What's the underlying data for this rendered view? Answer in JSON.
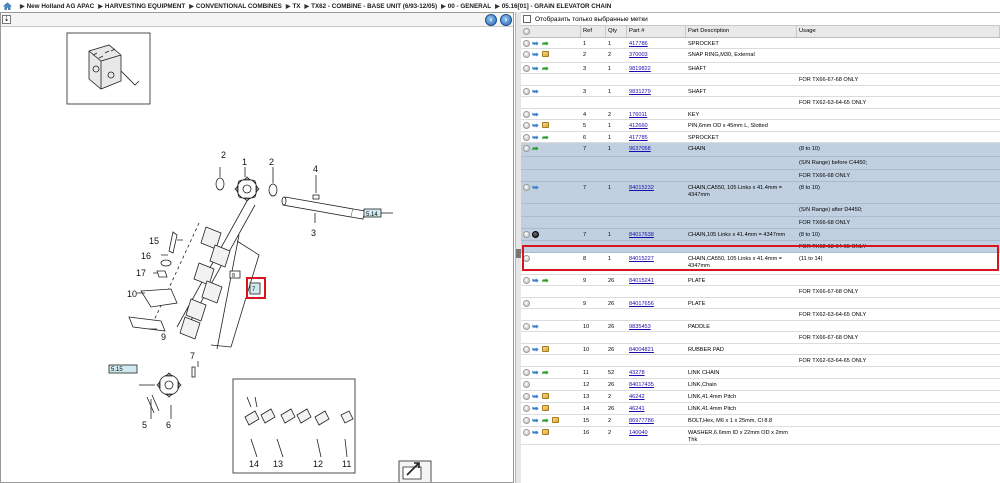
{
  "breadcrumb": [
    "New Holland AG APAC",
    "HARVESTING EQUIPMENT",
    "CONVENTIONAL COMBINES",
    "TX",
    "TX62 - COMBINE - BASE UNIT (6/93-12/05)",
    "00 - GENERAL",
    "05.16[01] - GRAIN ELEVATOR CHAIN"
  ],
  "filter_label": "Отобразить только выбранные метки",
  "columns": [
    "Ref",
    "Qty",
    "Part #",
    "Part Description",
    "Usage"
  ],
  "rows": [
    {
      "icons": [
        "info",
        "arrow",
        "green"
      ],
      "ref": "1",
      "qty": "1",
      "part": "417786",
      "desc": "SPROCKET",
      "usage": "",
      "h": 11
    },
    {
      "icons": [
        "info",
        "arrow",
        "cube"
      ],
      "ref": "2",
      "qty": "2",
      "part": "370003",
      "desc": "SNAP RING,M30, External",
      "usage": "",
      "h": 14
    },
    {
      "icons": [
        "info",
        "arrow",
        "green"
      ],
      "ref": "3",
      "qty": "1",
      "part": "9819822",
      "desc": "SHAFT",
      "usage": "",
      "h": 11
    },
    {
      "icons": [],
      "ref": "",
      "qty": "",
      "part": "",
      "desc": "",
      "usage": "FOR TX66-67-68 ONLY",
      "h": 12,
      "sub": true
    },
    {
      "icons": [
        "info",
        "arrow"
      ],
      "ref": "3",
      "qty": "1",
      "part": "9831279",
      "desc": "SHAFT",
      "usage": "",
      "h": 11
    },
    {
      "icons": [],
      "ref": "",
      "qty": "",
      "part": "",
      "desc": "",
      "usage": "FOR TX62-63-64-65 ONLY",
      "h": 12,
      "sub": true
    },
    {
      "icons": [
        "info",
        "arrow"
      ],
      "ref": "4",
      "qty": "2",
      "part": "176011",
      "desc": "KEY",
      "usage": "",
      "h": 11
    },
    {
      "icons": [
        "info",
        "arrow",
        "cube"
      ],
      "ref": "5",
      "qty": "1",
      "part": "412660",
      "desc": "PIN,6mm OD x 45mm L, Slotted",
      "usage": "",
      "h": 12
    },
    {
      "icons": [
        "info",
        "arrow",
        "green"
      ],
      "ref": "6",
      "qty": "1",
      "part": "417785",
      "desc": "SPROCKET",
      "usage": "",
      "h": 11
    },
    {
      "icons": [
        "info",
        "green"
      ],
      "ref": "7",
      "qty": "1",
      "part": "9637058",
      "desc": "CHAIN",
      "usage": "(8 to 10)",
      "h": 14,
      "hl": true
    },
    {
      "icons": [],
      "ref": "",
      "qty": "",
      "part": "",
      "desc": "",
      "usage": "(S/N Range) before C4450;",
      "h": 13,
      "hl": true
    },
    {
      "icons": [],
      "ref": "",
      "qty": "",
      "part": "",
      "desc": "",
      "usage": "FOR TX66-68 ONLY",
      "h": 12,
      "hl": true
    },
    {
      "icons": [
        "info",
        "arrow"
      ],
      "ref": "7",
      "qty": "1",
      "part": "84015232",
      "desc": "CHAIN,CA550, 105 Links x 41.4mm = 4347mm",
      "usage": "(8 to 10)",
      "h": 22,
      "hl": true
    },
    {
      "icons": [],
      "ref": "",
      "qty": "",
      "part": "",
      "desc": "",
      "usage": "(S/N Range) after D4450;",
      "h": 13,
      "hl": true
    },
    {
      "icons": [],
      "ref": "",
      "qty": "",
      "part": "",
      "desc": "",
      "usage": "FOR TX66-68 ONLY",
      "h": 12,
      "hl": true
    },
    {
      "icons": [
        "info",
        "dark"
      ],
      "ref": "7",
      "qty": "1",
      "part": "84017638",
      "desc": "CHAIN,105 Links x 41.4mm = 4347mm",
      "usage": "(8 to 10)",
      "h": 12,
      "hl": true
    },
    {
      "icons": [],
      "ref": "",
      "qty": "",
      "part": "",
      "desc": "",
      "usage": "FOR TX62-63-64-65 ONLY",
      "h": 12,
      "hl": true
    },
    {
      "icons": [
        "info"
      ],
      "ref": "8",
      "qty": "1",
      "part": "84015227",
      "desc": "CHAIN,CA550, 105 Links x 41.4mm = 4347mm",
      "usage": "(11 to 14)",
      "h": 22
    },
    {
      "icons": [
        "info",
        "arrow",
        "green"
      ],
      "ref": "9",
      "qty": "26",
      "part": "84015241",
      "desc": "PLATE",
      "usage": "",
      "h": 11
    },
    {
      "icons": [],
      "ref": "",
      "qty": "",
      "part": "",
      "desc": "",
      "usage": "FOR TX66-67-68 ONLY",
      "h": 12,
      "sub": true
    },
    {
      "icons": [
        "info"
      ],
      "ref": "9",
      "qty": "26",
      "part": "84017656",
      "desc": "PLATE",
      "usage": "",
      "h": 11
    },
    {
      "icons": [],
      "ref": "",
      "qty": "",
      "part": "",
      "desc": "",
      "usage": "FOR TX62-63-64-65 ONLY",
      "h": 12,
      "sub": true
    },
    {
      "icons": [
        "info",
        "arrow"
      ],
      "ref": "10",
      "qty": "26",
      "part": "9835453",
      "desc": "PADDLE",
      "usage": "",
      "h": 11
    },
    {
      "icons": [],
      "ref": "",
      "qty": "",
      "part": "",
      "desc": "",
      "usage": "FOR TX66-67-68 ONLY",
      "h": 12,
      "sub": true
    },
    {
      "icons": [
        "info",
        "arrow",
        "cube"
      ],
      "ref": "10",
      "qty": "26",
      "part": "84004821",
      "desc": "RUBBER PAD",
      "usage": "",
      "h": 11
    },
    {
      "icons": [],
      "ref": "",
      "qty": "",
      "part": "",
      "desc": "",
      "usage": "FOR TX62-63-64-65 ONLY",
      "h": 12,
      "sub": true
    },
    {
      "icons": [
        "info",
        "arrow",
        "green"
      ],
      "ref": "11",
      "qty": "52",
      "part": "43278",
      "desc": "LINK CHAIN",
      "usage": "",
      "h": 12
    },
    {
      "icons": [
        "info"
      ],
      "ref": "12",
      "qty": "26",
      "part": "84017435",
      "desc": "LINK,Chain",
      "usage": "",
      "h": 12
    },
    {
      "icons": [
        "info",
        "arrow",
        "cube"
      ],
      "ref": "13",
      "qty": "2",
      "part": "46242",
      "desc": "LINK,41.4mm Pitch",
      "usage": "",
      "h": 12
    },
    {
      "icons": [
        "info",
        "arrow",
        "cube"
      ],
      "ref": "14",
      "qty": "26",
      "part": "46241",
      "desc": "LINK,41.4mm Pitch",
      "usage": "",
      "h": 12
    },
    {
      "icons": [
        "info",
        "arrow",
        "green",
        "cube"
      ],
      "ref": "15",
      "qty": "2",
      "part": "86977786",
      "desc": "BOLT,Hex, M6 x 1 x 25mm, Cl 8.8",
      "usage": "",
      "h": 12
    },
    {
      "icons": [
        "info",
        "arrow",
        "cube"
      ],
      "ref": "16",
      "qty": "2",
      "part": "140040",
      "desc": "WASHER,6.6mm ID x 22mm OD x 2mm Thk",
      "usage": "",
      "h": 18
    }
  ],
  "diagram_labels": [
    "1",
    "2",
    "2",
    "3",
    "4",
    "5",
    "6",
    "7",
    "8",
    "9",
    "10",
    "11",
    "12",
    "13",
    "14",
    "15",
    "16",
    "17"
  ],
  "diagram_refs": [
    "5.14",
    "5.15"
  ]
}
